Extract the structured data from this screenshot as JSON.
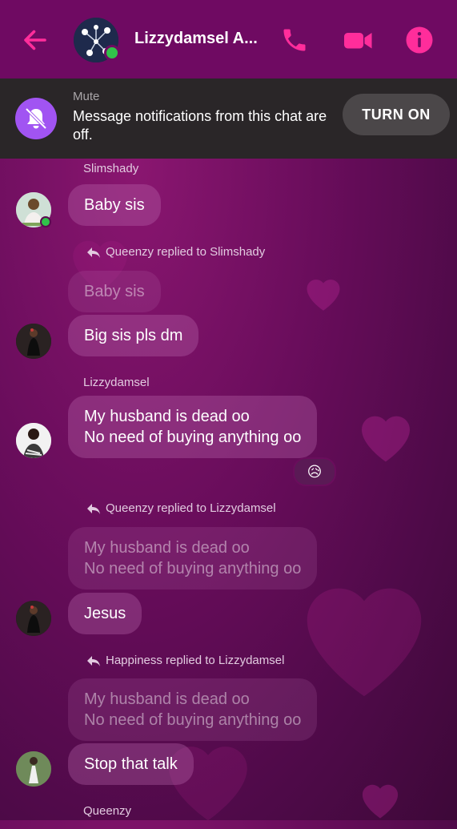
{
  "header": {
    "title": "Lizzydamsel A...",
    "colors": {
      "bar": "#6f0a62",
      "accent": "#ff2d9b"
    }
  },
  "mute_banner": {
    "label": "Mute",
    "text": "Message notifications from this chat are off.",
    "button": "TURN ON"
  },
  "messages": [
    {
      "sender": "Slimshady",
      "text": "Baby sis"
    },
    {
      "reply_note": "Queenzy replied to Slimshady",
      "quoted": "Baby sis",
      "text": "Big sis pls dm"
    },
    {
      "sender": "Lizzydamsel",
      "line1": "My husband is dead oo",
      "line2": "No need of buying anything oo",
      "reaction": "😥"
    },
    {
      "reply_note": "Queenzy replied to Lizzydamsel",
      "quoted1": "My husband is dead oo",
      "quoted2": "No need of buying anything oo",
      "text": "Jesus"
    },
    {
      "reply_note": "Happiness replied to Lizzydamsel",
      "quoted1": "My husband is dead oo",
      "quoted2": "No need of buying anything oo",
      "text": "Stop that talk"
    },
    {
      "sender": "Queenzy"
    }
  ]
}
